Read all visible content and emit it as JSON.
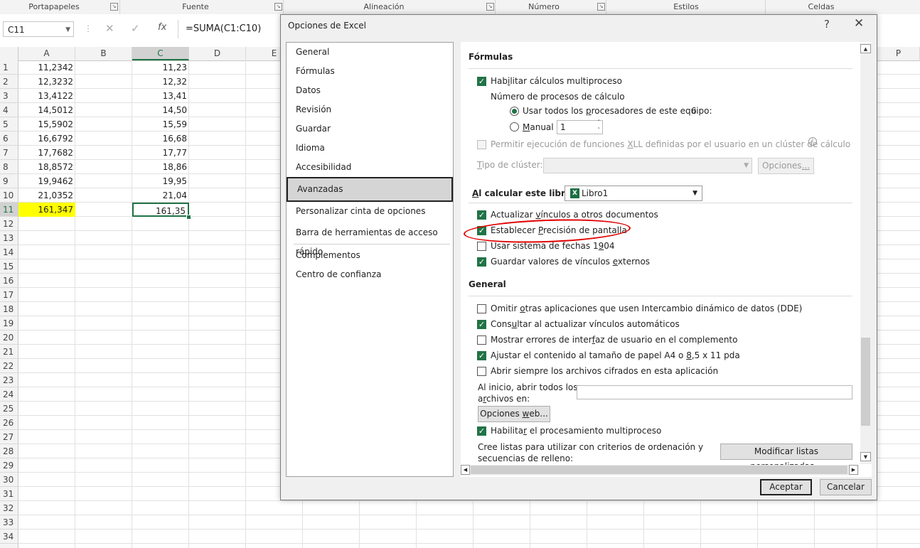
{
  "ribbon": {
    "groups": [
      {
        "label": "Portapapeles"
      },
      {
        "label": "Fuente"
      },
      {
        "label": "Alineación"
      },
      {
        "label": "Número"
      },
      {
        "label": "Estilos"
      },
      {
        "label": "Celdas"
      }
    ]
  },
  "formula_bar": {
    "name_box": "C11",
    "cancel_icon": "✕",
    "enter_icon": "✓",
    "fx_label": "fx",
    "formula": "=SUMA(C1:C10)"
  },
  "sheet": {
    "columns": [
      "A",
      "B",
      "C",
      "D",
      "E",
      "P"
    ],
    "rows": [
      "1",
      "2",
      "3",
      "4",
      "5",
      "6",
      "7",
      "8",
      "9",
      "10",
      "11",
      "12",
      "13",
      "14",
      "15",
      "16",
      "17",
      "18",
      "19",
      "20",
      "21",
      "22",
      "23",
      "24",
      "25",
      "26",
      "27",
      "28",
      "29",
      "30",
      "31",
      "32",
      "33",
      "34"
    ],
    "col_a": [
      "11,2342",
      "12,3232",
      "13,4122",
      "14,5012",
      "15,5902",
      "16,6792",
      "17,7682",
      "18,8572",
      "19,9462",
      "21,0352",
      "161,347"
    ],
    "col_c": [
      "11,23",
      "12,32",
      "13,41",
      "14,50",
      "15,59",
      "16,68",
      "17,77",
      "18,86",
      "19,95",
      "21,04",
      "161,35"
    ],
    "highlight_color": "#ffff00",
    "accent_color": "#217346"
  },
  "dialog": {
    "title": "Opciones de Excel",
    "help": "?",
    "close": "✕",
    "nav": [
      "General",
      "Fórmulas",
      "Datos",
      "Revisión",
      "Guardar",
      "Idioma",
      "Accesibilidad",
      "Avanzadas",
      "Personalizar cinta de opciones",
      "Barra de herramientas de acceso rápido",
      "Complementos",
      "Centro de confianza"
    ],
    "selected_nav": "Avanzadas",
    "formulas": {
      "heading": "Fórmulas",
      "multithread_pre": "Hab",
      "multithread_u": "i",
      "multithread_post": "litar cálculos multiproceso",
      "threads_label": "Número de procesos de cálculo",
      "use_all_pre": "Usar todos los ",
      "use_all_u": "p",
      "use_all_post": "rocesadores de este equipo:",
      "processor_count": "6",
      "manual_u": "M",
      "manual_post": "anual",
      "manual_value": "1",
      "xll_pre": "Permitir ejecución de funciones ",
      "xll_u": "X",
      "xll_post": "LL definidas por el usuario en un clúster de cálculo",
      "cluster_label_u": "T",
      "cluster_label_post": "ipo de clúster:",
      "cluster_options_button_pre": "Opciones",
      "cluster_options_button_u": "...",
      "cluster_options_button_post": ""
    },
    "calc_book": {
      "label_pre": "",
      "label_u": "A",
      "label_post": "l calcular este libro:",
      "book": "Libro1",
      "update_links_pre": "Actualizar ",
      "update_links_u": "v",
      "update_links_post": "ínculos a otros documentos",
      "precision_pre": "Establecer ",
      "precision_u": "P",
      "precision_post": "recisión de pantalla",
      "date1904_pre": "Usar sistema de fechas 1",
      "date1904_u": "9",
      "date1904_post": "04",
      "save_ext_pre": "Guardar valores de vínculos ",
      "save_ext_u": "e",
      "save_ext_post": "xternos"
    },
    "general": {
      "heading": "General",
      "dde_pre": "Omitir ",
      "dde_u": "o",
      "dde_post": "tras aplicaciones que usen Intercambio dinámico de datos (DDE)",
      "auto_links_pre": "Cons",
      "auto_links_u": "u",
      "auto_links_post": "ltar al actualizar vínculos automáticos",
      "ui_errors_pre": "Mostrar errores de inter",
      "ui_errors_u": "f",
      "ui_errors_post": "az de usuario en el complemento",
      "a4_pre": "Ajustar el contenido al tamaño de papel A4 o ",
      "a4_u": "8",
      "a4_post": ",5 x 11 pda",
      "encrypted": "Abrir siempre los archivos cifrados en esta aplicación",
      "startup_line1": "Al inicio, abrir todos los",
      "startup_line2_pre": "a",
      "startup_line2_u": "r",
      "startup_line2_post": "chivos en:",
      "startup_value": "",
      "web_options_pre": "Opciones ",
      "web_options_u": "w",
      "web_options_post": "eb...",
      "multiprocess_pre": "Habilita",
      "multiprocess_u": "r",
      "multiprocess_post": " el procesamiento multiproceso",
      "custom_lists_line1": "Cree listas para utilizar con criterios de ordenación y",
      "custom_lists_line2": "secuencias de relleno:",
      "custom_lists_button_pre": "Modificar listas personali",
      "custom_lists_button_u": "z",
      "custom_lists_button_post": "adas..."
    },
    "ok_label": "Aceptar",
    "cancel_label": "Cancelar"
  }
}
